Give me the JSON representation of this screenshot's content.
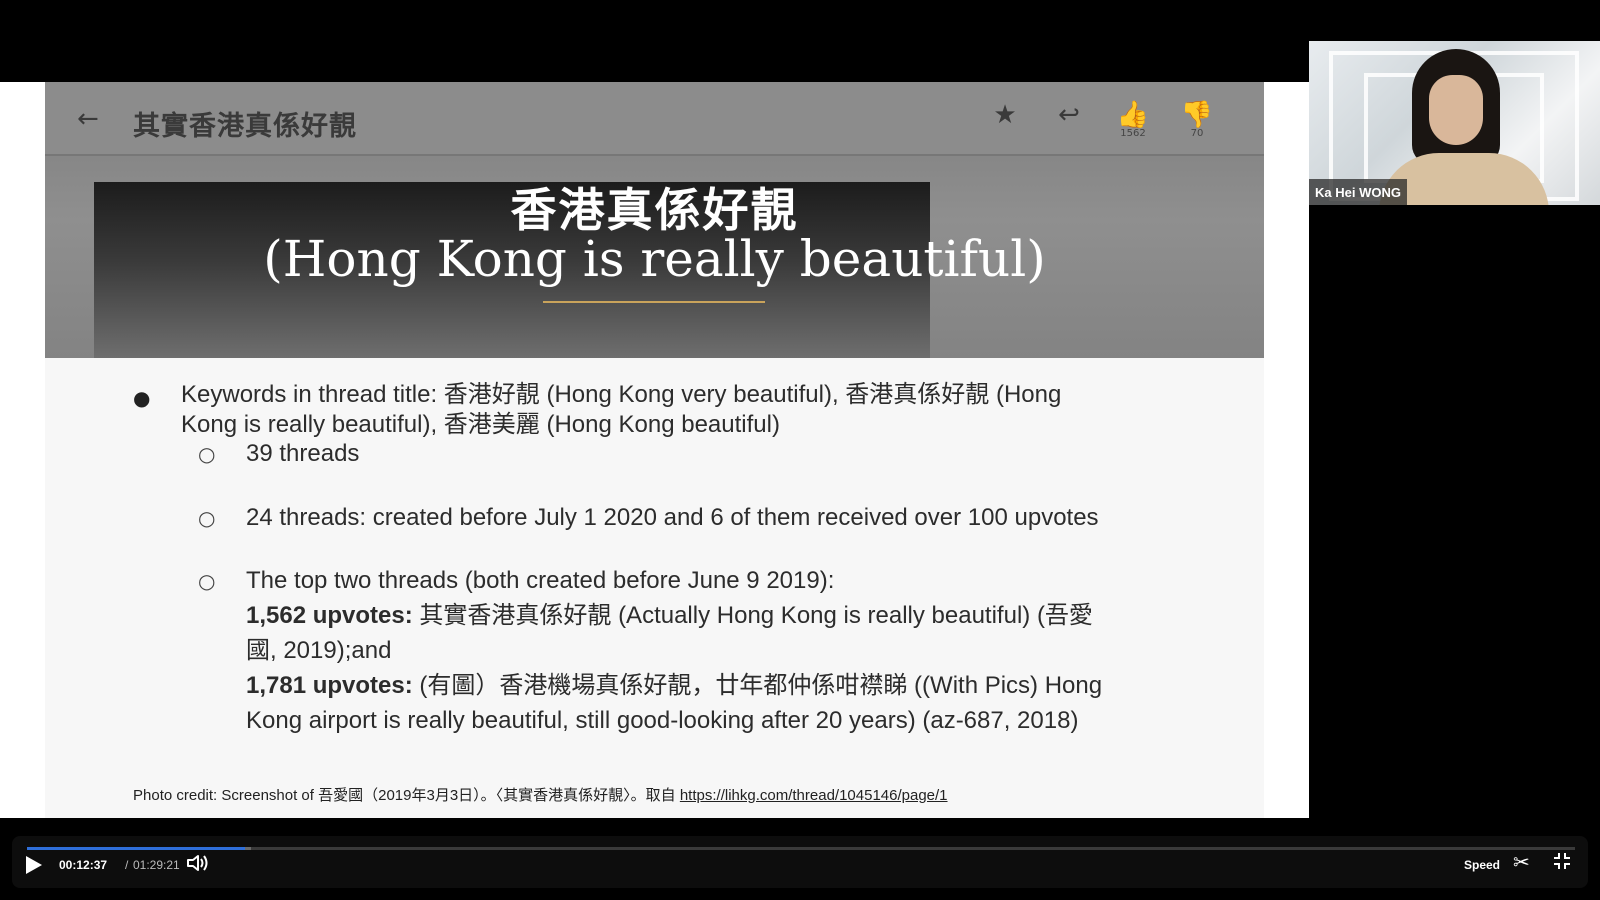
{
  "slide": {
    "banner": {
      "back_icon": "arrow-left-icon",
      "thread_title": "其實香港真係好靚",
      "upvotes_small": "1562",
      "downvotes_small": "70",
      "headline_zh": "香港真係好靚",
      "headline_en": "(Hong Kong is really beautiful)"
    },
    "bullet_main_line1": "Keywords in thread title: 香港好靚 (Hong Kong very beautiful), 香港真係好靚 (Hong",
    "bullet_main_line2": "Kong is really beautiful), 香港美麗 (Hong Kong beautiful)",
    "sub1": "39 threads",
    "sub2": "24 threads: created before July 1 2020 and 6 of them received over 100 upvotes",
    "sub3_line1": "The top two threads (both created before June 9 2019):",
    "sub3_bold1": "1,562 upvotes:",
    "sub3_text1": " 其實香港真係好靚 (Actually Hong Kong is really beautiful) (吾愛",
    "sub3_line3": "國, 2019);and",
    "sub3_bold2": "1,781 upvotes:",
    "sub3_text2": " (有圖）香港機場真係好靚，廿年都仲係咁襟睇 ((With Pics) Hong",
    "sub3_line5": "Kong airport is really beautiful, still good-looking after 20 years) (az-687, 2018)",
    "credit_prefix": "Photo credit: Screenshot of 吾愛國（2019年3月3日）。〈其實香港真係好靚〉。取自 ",
    "credit_link": "https://lihkg.com/thread/1045146/page/1"
  },
  "video_tile": {
    "participant_name": "Ka Hei WONG"
  },
  "player": {
    "current_time": "00:12:37",
    "separator": "/",
    "total_time": "01:29:21",
    "speed_label": "Speed",
    "progress_fraction": 0.141,
    "accent_color": "#2f6fd9"
  }
}
